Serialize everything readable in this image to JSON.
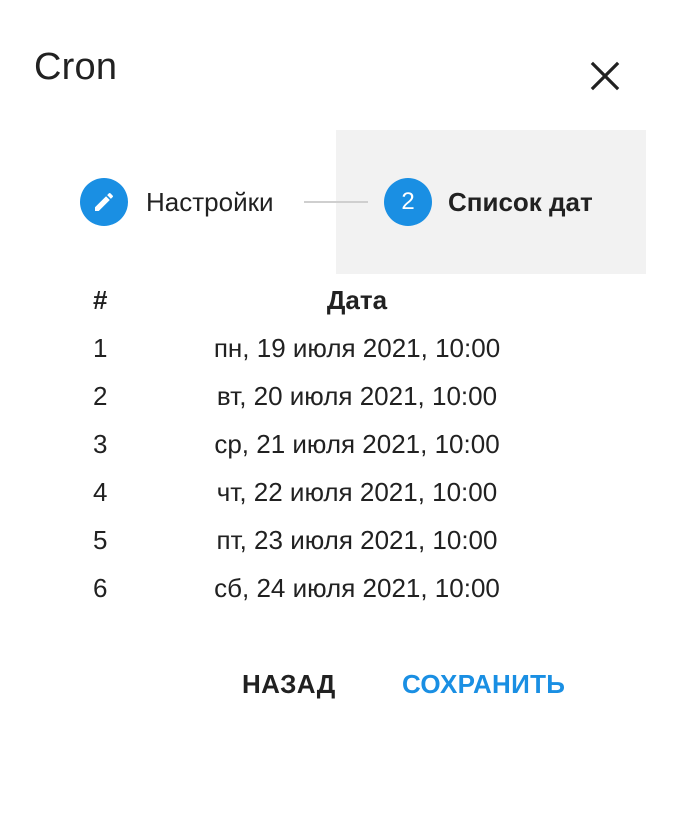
{
  "dialog": {
    "title": "Cron",
    "close_icon": "close-icon"
  },
  "stepper": {
    "steps": [
      {
        "label": "Настройки",
        "icon": "pencil-icon",
        "state": "completed"
      },
      {
        "label": "Список дат",
        "number": "2",
        "state": "active"
      }
    ]
  },
  "table": {
    "headers": {
      "num": "#",
      "date": "Дата"
    },
    "rows": [
      {
        "num": "1",
        "date": "пн, 19 июля 2021, 10:00"
      },
      {
        "num": "2",
        "date": "вт, 20 июля 2021, 10:00"
      },
      {
        "num": "3",
        "date": "ср, 21 июля 2021, 10:00"
      },
      {
        "num": "4",
        "date": "чт, 22 июля 2021, 10:00"
      },
      {
        "num": "5",
        "date": "пт, 23 июля 2021, 10:00"
      },
      {
        "num": "6",
        "date": "сб, 24 июля 2021, 10:00"
      }
    ]
  },
  "actions": {
    "back_label": "НАЗАД",
    "save_label": "СОХРАНИТЬ"
  },
  "colors": {
    "accent": "#1a8fe3",
    "active_step_bg": "#f2f2f2",
    "text": "#212121"
  }
}
